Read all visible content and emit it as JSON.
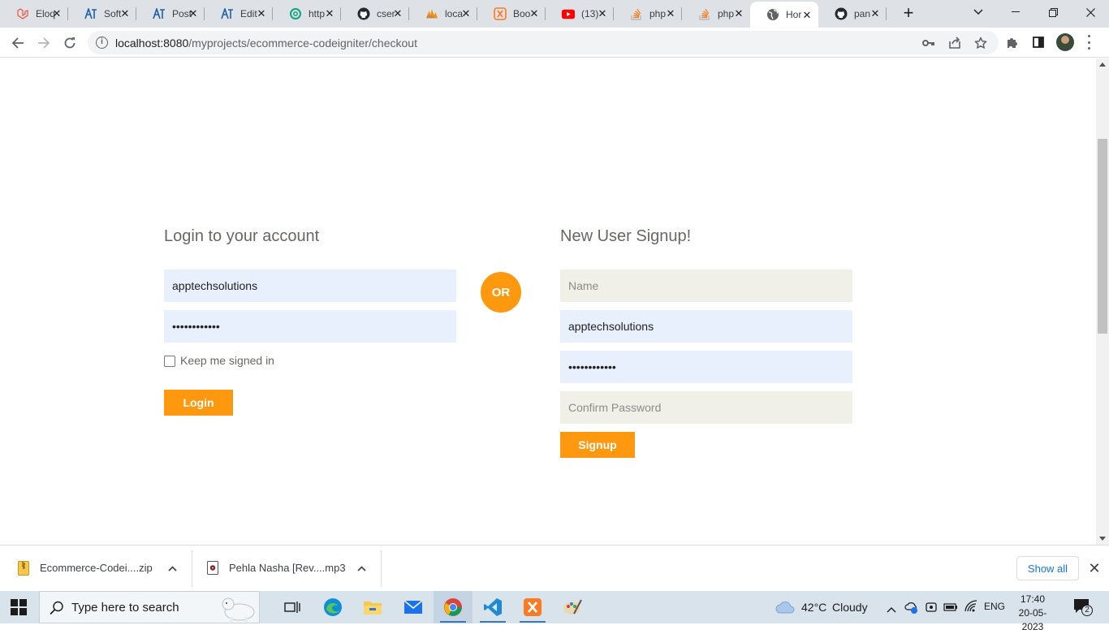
{
  "browser": {
    "tabs": [
      {
        "title": "Eloq",
        "icon": "laravel-icon",
        "color": "#f05340"
      },
      {
        "title": "Soft",
        "icon": "ats-icon",
        "color": "#1f5fa8"
      },
      {
        "title": "Post",
        "icon": "ats-icon",
        "color": "#1f5fa8"
      },
      {
        "title": "Edit",
        "icon": "ats-icon",
        "color": "#1f5fa8"
      },
      {
        "title": "http",
        "icon": "openai-icon",
        "color": "#10a37f"
      },
      {
        "title": "cser",
        "icon": "github-icon",
        "color": "#24292f"
      },
      {
        "title": "loca",
        "icon": "phpmyadmin-icon",
        "color": "#f29111"
      },
      {
        "title": "Boo",
        "icon": "xampp-icon",
        "color": "#fb7a24"
      },
      {
        "title": "(13)",
        "icon": "youtube-icon",
        "color": "#ff0000"
      },
      {
        "title": "php",
        "icon": "stackoverflow-icon",
        "color": "#f48024"
      },
      {
        "title": "php",
        "icon": "stackoverflow-icon",
        "color": "#f48024"
      },
      {
        "title": "Hor",
        "icon": "globe-icon",
        "color": "#5f6368",
        "active": true
      },
      {
        "title": "pan",
        "icon": "github-icon",
        "color": "#24292f"
      }
    ],
    "url_host": "localhost:8080",
    "url_path": "/myprojects/ecommerce-codeigniter/checkout"
  },
  "login": {
    "title": "Login to your account",
    "username": "apptechsolutions",
    "password": "••••••••••••",
    "keep_signed_in": "Keep me signed in",
    "button": "Login"
  },
  "or_label": "OR",
  "signup": {
    "title": "New User Signup!",
    "name_placeholder": "Name",
    "email": "apptechsolutions",
    "password": "••••••••••••",
    "confirm_placeholder": "Confirm Password",
    "button": "Signup"
  },
  "downloads": {
    "items": [
      {
        "name": "Ecommerce-Codei....zip",
        "icon": "zip-file-icon"
      },
      {
        "name": "Pehla Nasha [Rev....mp3",
        "icon": "audio-file-icon"
      }
    ],
    "show_all": "Show all"
  },
  "taskbar": {
    "search_placeholder": "Type here to search",
    "weather_temp": "42°C",
    "weather_text": "Cloudy",
    "lang": "ENG",
    "time": "17:40",
    "date": "20-05-2023",
    "notification_count": "2"
  },
  "colors": {
    "accent": "#fe980f",
    "autofill": "#e8f0fe",
    "input_bg": "#f0f0e9"
  }
}
